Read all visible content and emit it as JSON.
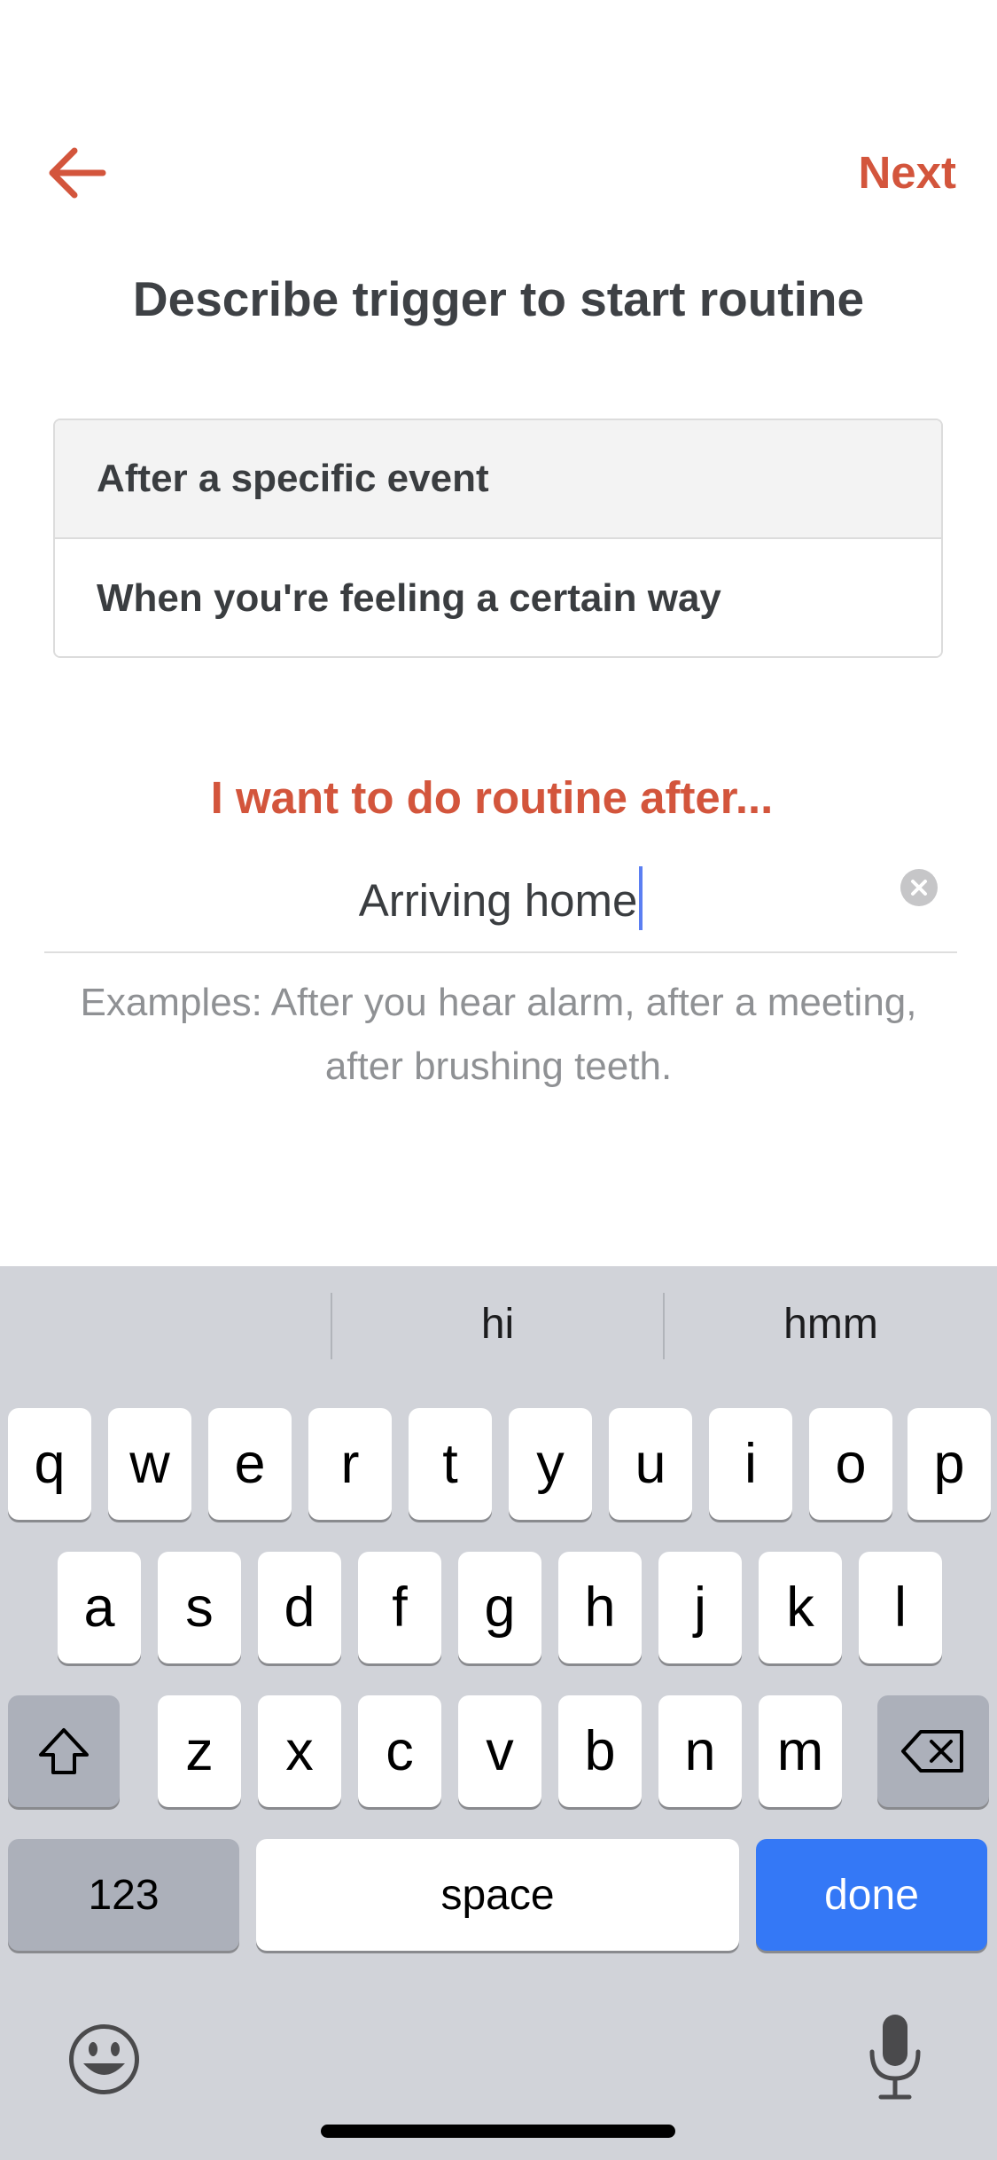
{
  "header": {
    "back_icon": "arrow-left-icon",
    "next_label": "Next",
    "title": "Describe trigger to start routine"
  },
  "options": [
    {
      "label": "After a specific event",
      "selected": true
    },
    {
      "label": "When you're feeling a certain way",
      "selected": false
    }
  ],
  "prompt": "I want to do routine after...",
  "input": {
    "value": "Arriving home",
    "clear_icon": "clear-circle-icon"
  },
  "examples": {
    "line1": "Examples: After you hear alarm, after a meeting,",
    "line2": "after brushing teeth."
  },
  "keyboard": {
    "suggestions": [
      "",
      "hi",
      "hmm"
    ],
    "row1": [
      "q",
      "w",
      "e",
      "r",
      "t",
      "y",
      "u",
      "i",
      "o",
      "p"
    ],
    "row2": [
      "a",
      "s",
      "d",
      "f",
      "g",
      "h",
      "j",
      "k",
      "l"
    ],
    "row3": [
      "z",
      "x",
      "c",
      "v",
      "b",
      "n",
      "m"
    ],
    "shift_icon": "shift-icon",
    "delete_icon": "backspace-icon",
    "numbers_label": "123",
    "space_label": "space",
    "done_label": "done",
    "emoji_icon": "emoji-icon",
    "mic_icon": "microphone-icon"
  },
  "colors": {
    "accent": "#d3553c",
    "done_key": "#3478f6",
    "keyboard_bg": "#d1d3d9"
  }
}
